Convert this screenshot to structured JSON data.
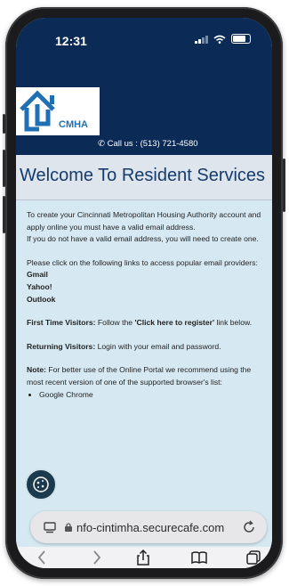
{
  "status_bar": {
    "time": "12:31"
  },
  "header": {
    "logo_text": "CMHA",
    "call_text": "Call us : (513) 721-4580"
  },
  "page": {
    "title": "Welcome To Resident Services",
    "intro_1": "To create your Cincinnati Metropolitan Housing Authority account and apply online you must have a valid email address.",
    "intro_2": "If you do not have a valid email address, you will need to create one.",
    "links_intro": "Please click on the following links to access popular email providers:",
    "links": [
      "Gmail",
      "Yahoo!",
      "Outlook"
    ],
    "first_time_label": "First Time Visitors:",
    "first_time_text_1": " Follow the ",
    "first_time_link": "'Click here to register'",
    "first_time_text_2": " link below.",
    "returning_label": "Returning Visitors:",
    "returning_text": " Login with your email and password.",
    "note_label": "Note:",
    "note_text": " For better use of the Online Portal we recommend using the most recent version of one of the supported browser's list:",
    "browsers": [
      "Google Chrome"
    ]
  },
  "browser": {
    "url": "nfo-cintimha.securecafe.com"
  },
  "colors": {
    "header_bg": "#0b2a55",
    "title_color": "#143b6d",
    "content_bg": "#d6e9f3"
  }
}
